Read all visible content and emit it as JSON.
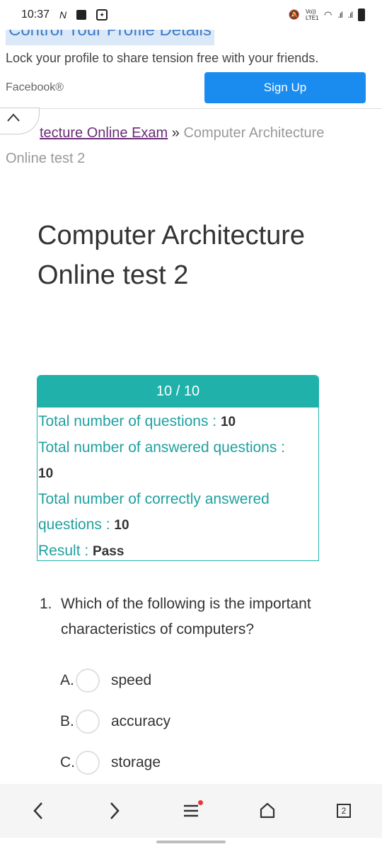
{
  "status": {
    "time": "10:37",
    "network_label": "Vo)) LTE1",
    "tab_count": "2"
  },
  "ad": {
    "heading": "Control Your Profile Details",
    "text": "Lock your profile to share tension free with your friends.",
    "source": "Facebook®",
    "button": "Sign Up"
  },
  "breadcrumb": {
    "link": "tecture Online Exam",
    "separator": "»",
    "current": "Computer Architecture Online test 2"
  },
  "page_title": "Computer Architecture Online test 2",
  "result": {
    "score": "10 / 10",
    "total_label": "Total number of questions : ",
    "total_value": "10",
    "answered_label": "Total number of answered questions : ",
    "answered_value": "10",
    "correct_label": "Total number of correctly answered questions : ",
    "correct_value": "10",
    "result_label": "Result : ",
    "result_value": "Pass"
  },
  "question": {
    "number": "1.",
    "text": "Which of the following is the important characteristics of computers?",
    "options": [
      {
        "letter": "A.",
        "label": "speed"
      },
      {
        "letter": "B.",
        "label": "accuracy"
      },
      {
        "letter": "C.",
        "label": "storage"
      }
    ]
  },
  "colors": {
    "accent": "#20b2aa",
    "button": "#1a8cf0",
    "link": "#6a2c78"
  }
}
